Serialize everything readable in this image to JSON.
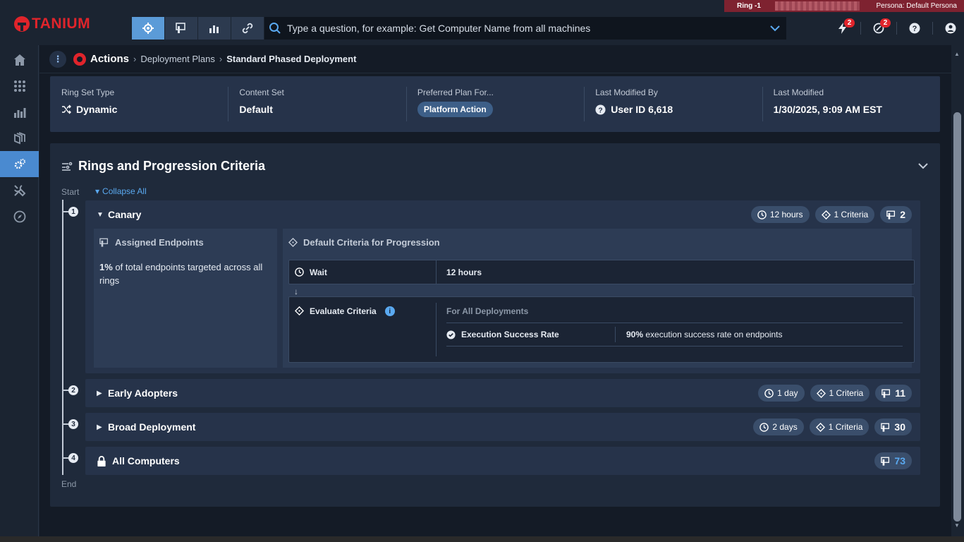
{
  "banner": {
    "ring": "Ring -1",
    "persona": "Persona: Default Persona",
    "colors": {
      "bg": "#7e2230"
    }
  },
  "header": {
    "logo_text": "TANIUM",
    "search_placeholder": "Type a question, for example: Get Computer Name from all machines",
    "nav_buttons": [
      "interact-icon",
      "endpoints-icon",
      "reports-icon",
      "connect-icon"
    ],
    "alerts_count": "2",
    "notifications_count": "2"
  },
  "sidebar": {
    "items": [
      "home-icon",
      "modules-icon",
      "reports-icon",
      "packages-icon",
      "actions-icon",
      "tools-icon",
      "explore-icon"
    ],
    "active_index": 4
  },
  "breadcrumb": {
    "root": "Actions",
    "mid": "Deployment Plans",
    "last": "Standard Phased Deployment"
  },
  "info": {
    "ring_set_type_label": "Ring Set Type",
    "ring_set_type": "Dynamic",
    "content_set_label": "Content Set",
    "content_set": "Default",
    "preferred_label": "Preferred Plan For...",
    "preferred": "Platform Action",
    "modified_by_label": "Last Modified By",
    "modified_by": "User ID 6,618",
    "modified_label": "Last Modified",
    "modified": "1/30/2025, 9:09 AM EST"
  },
  "rings": {
    "title": "Rings and Progression Criteria",
    "start": "Start",
    "end": "End",
    "collapse_all": "Collapse All",
    "items": [
      {
        "num": "1",
        "name": "Canary",
        "duration": "12 hours",
        "criteria": "1 Criteria",
        "endpoints": "2"
      },
      {
        "num": "2",
        "name": "Early Adopters",
        "duration": "1 day",
        "criteria": "1 Criteria",
        "endpoints": "11"
      },
      {
        "num": "3",
        "name": "Broad Deployment",
        "duration": "2 days",
        "criteria": "1 Criteria",
        "endpoints": "30"
      },
      {
        "num": "4",
        "name": "All Computers",
        "endpoints": "73"
      }
    ],
    "canary_detail": {
      "assigned_title": "Assigned Endpoints",
      "assigned_pct": "1%",
      "assigned_text": "of total endpoints targeted across all rings",
      "criteria_title": "Default Criteria for Progression",
      "wait_label": "Wait",
      "wait_value": "12 hours",
      "eval_label": "Evaluate Criteria",
      "for_all": "For All Deployments",
      "crit_name": "Execution Success Rate",
      "crit_pct": "90%",
      "crit_text": "execution success rate on endpoints"
    }
  }
}
